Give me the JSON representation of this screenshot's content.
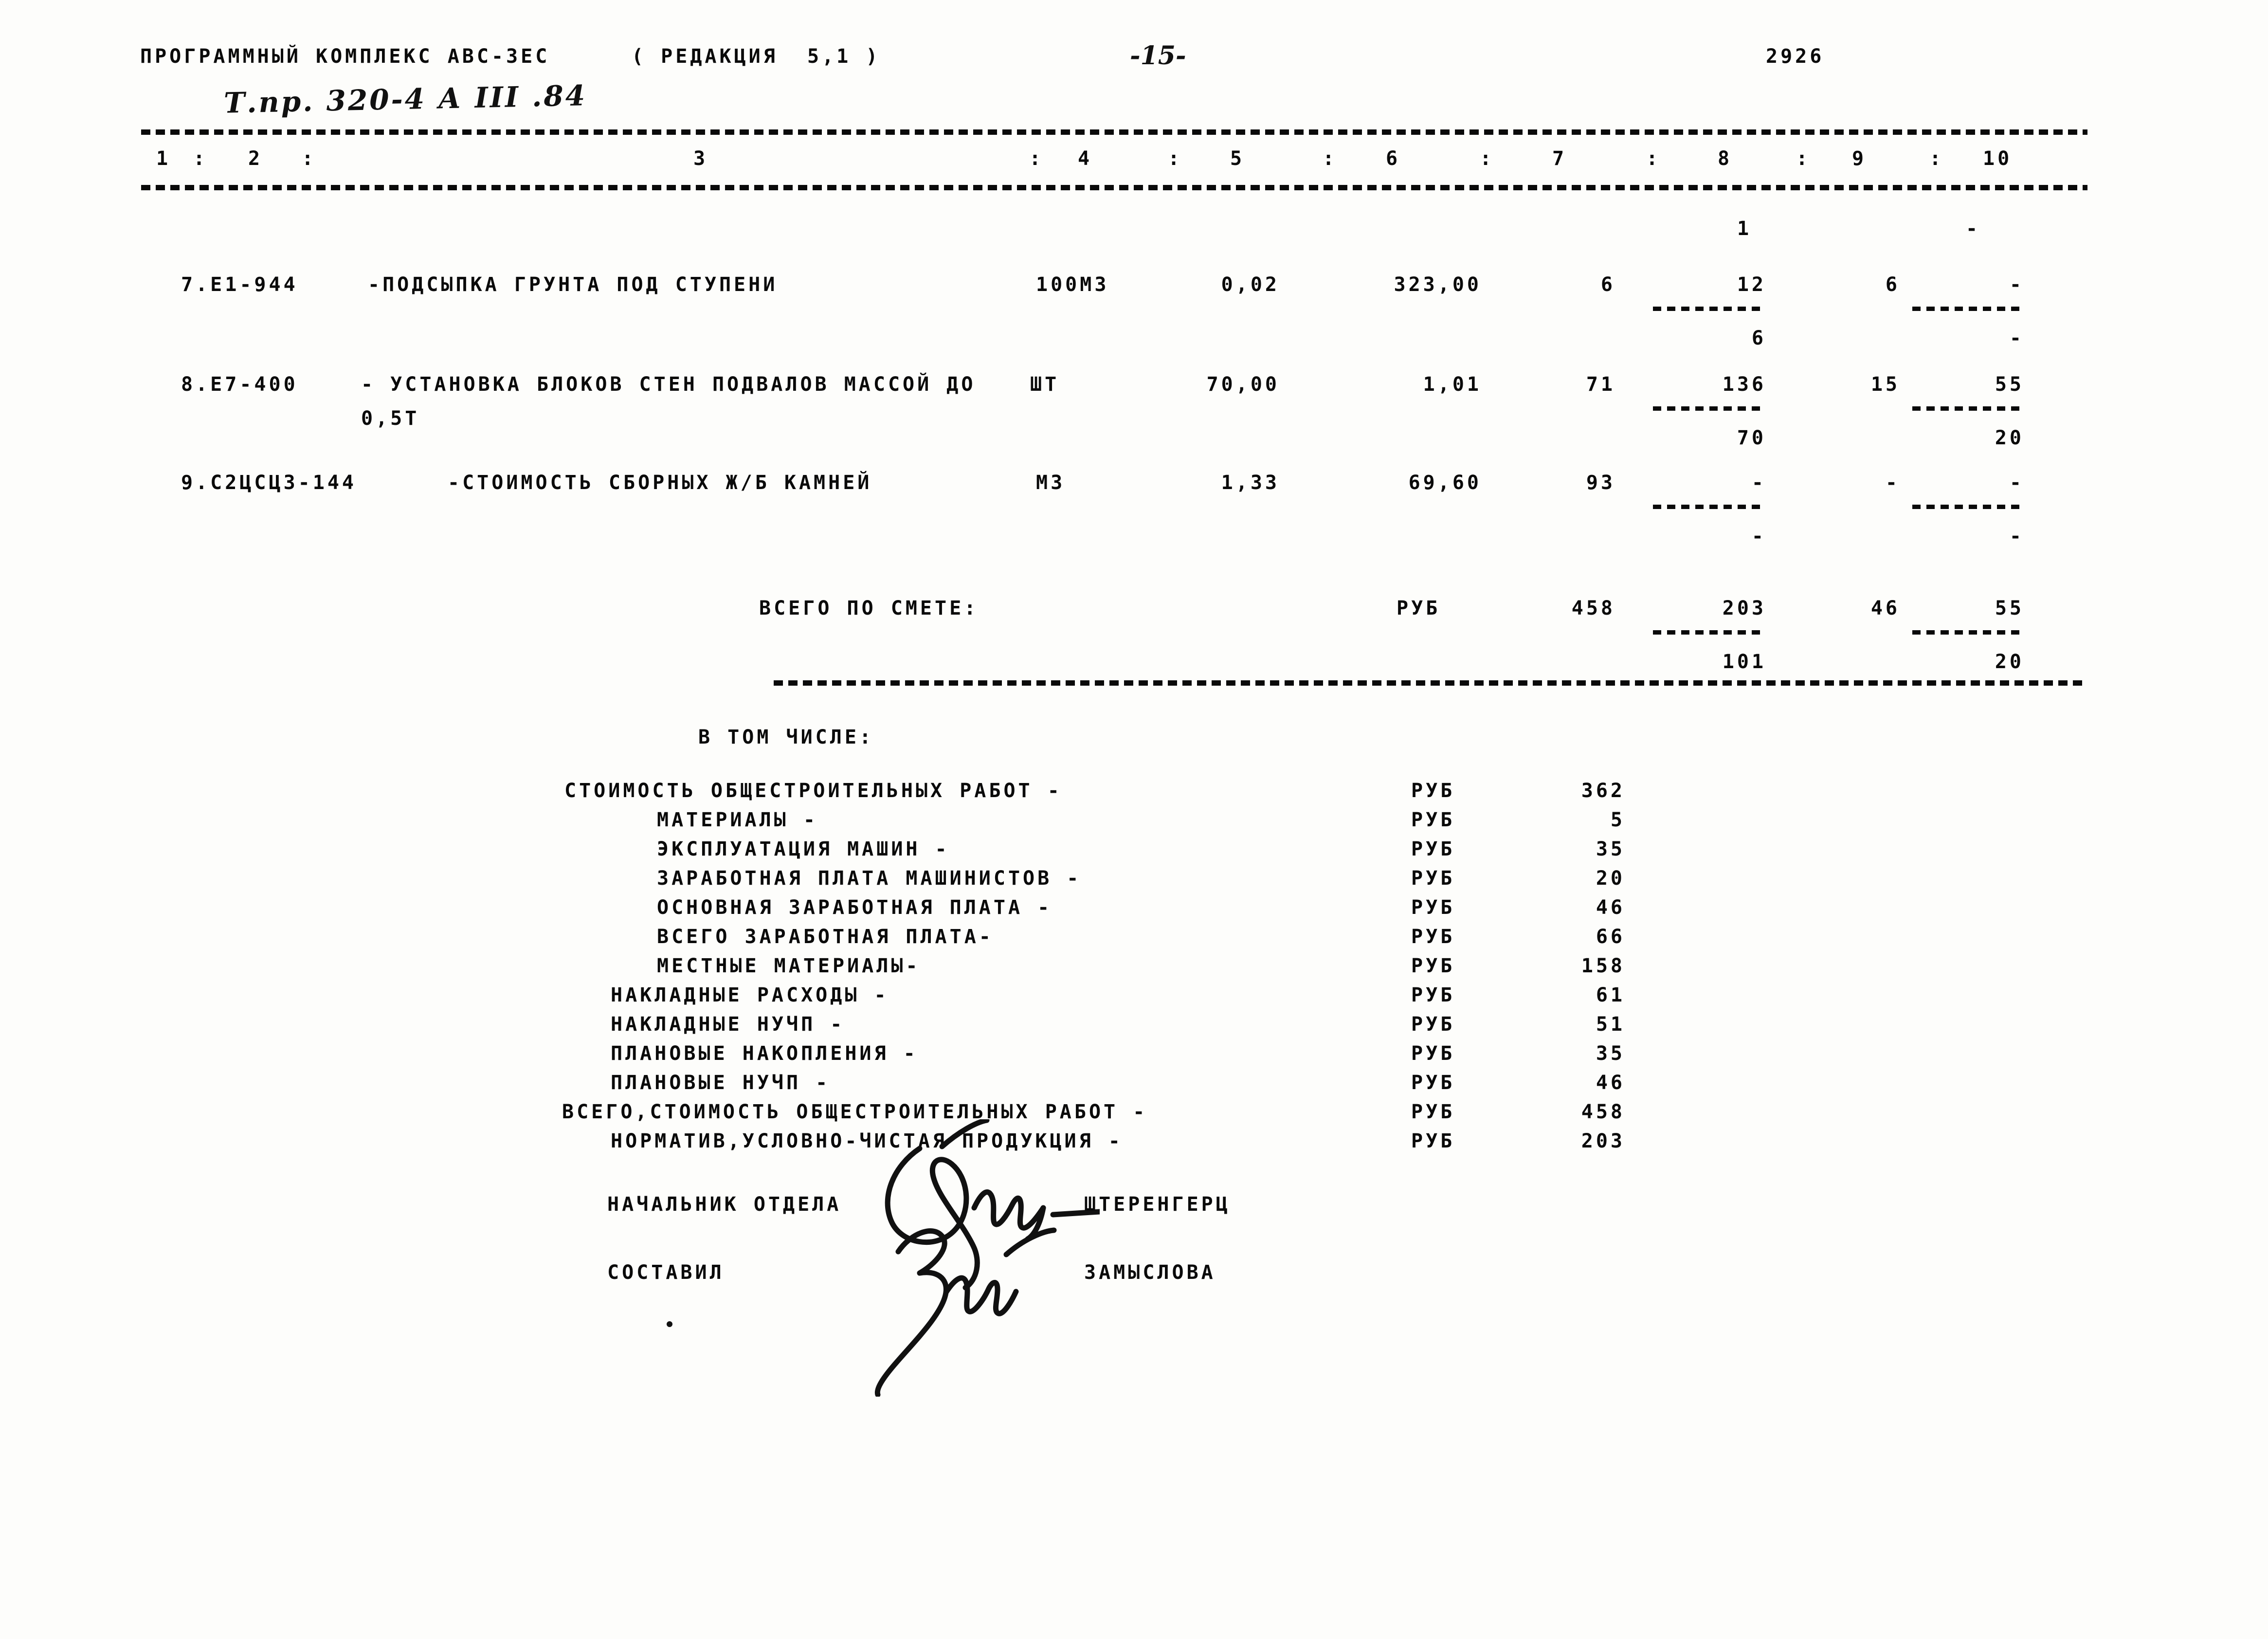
{
  "header": {
    "program_title": "ПРОГРАММНЫЙ КОМПЛЕКС АВС-3ЕС",
    "edition": "( РЕДАКЦИЯ  5,1 )",
    "page_number": "-15-",
    "doc_code": "2926",
    "handwritten_ref": "Т.пр. 320-4 А III .84"
  },
  "table": {
    "column_headers": [
      "1",
      ":",
      "2",
      ":",
      "3",
      ":",
      "4",
      ":",
      "5",
      ":",
      "6",
      ":",
      "7",
      ":",
      "8",
      ":",
      "9",
      ":",
      "10"
    ],
    "rows": [
      {
        "code": "7.Е1-944",
        "description": "-ПОДСЫПКА ГРУНТА ПОД СТУПЕНИ",
        "description_cont": "",
        "unit": "100М3",
        "qty": "0,02",
        "price": "323,00",
        "col7": "6",
        "col8_upper": "1",
        "col8": "12",
        "col8_sub": "6",
        "col9": "6",
        "col10_upper": "-",
        "col10": "-",
        "col10_sub": "-"
      },
      {
        "code": "8.Е7-400",
        "description": "- УСТАНОВКА БЛОКОВ СТЕН ПОДВАЛОВ МАССОЙ ДО",
        "description_cont": "0,5Т",
        "unit": "ШТ",
        "qty": "70,00",
        "price": "1,01",
        "col7": "71",
        "col8_upper": "",
        "col8": "136",
        "col8_sub": "70",
        "col9": "15",
        "col10_upper": "",
        "col10": "55",
        "col10_sub": "20"
      },
      {
        "code": "9.С2ЦСЦ3-144",
        "description": "-СТОИМОСТЬ СБОРНЫХ Ж/Б КАМНЕЙ",
        "description_cont": "",
        "unit": "М3",
        "qty": "1,33",
        "price": "69,60",
        "col7": "93",
        "col8_upper": "",
        "col8": "-",
        "col8_sub": "-",
        "col9": "-",
        "col10_upper": "",
        "col10": "-",
        "col10_sub": "-"
      }
    ],
    "total_row": {
      "label": "ВСЕГО ПО СМЕТЕ:",
      "unit": "РУБ",
      "col7": "458",
      "col8": "203",
      "col8_sub": "101",
      "col9": "46",
      "col10": "55",
      "col10_sub": "20"
    }
  },
  "breakdown": {
    "heading": "В ТОМ ЧИСЛЕ:",
    "currency_label": "РУБ",
    "items": [
      {
        "label": "СТОИМОСТЬ ОБЩЕСТРОИТЕЛЬНЫХ РАБОТ -",
        "indent": 0,
        "unit": "РУБ",
        "value": "362"
      },
      {
        "label": "МАТЕРИАЛЫ -",
        "indent": 1,
        "unit": "РУБ",
        "value": "5"
      },
      {
        "label": "ЭКСПЛУАТАЦИЯ МАШИН -",
        "indent": 1,
        "unit": "РУБ",
        "value": "35"
      },
      {
        "label": "ЗАРАБОТНАЯ ПЛАТА МАШИНИСТОВ -",
        "indent": 1,
        "unit": "РУБ",
        "value": "20"
      },
      {
        "label": "ОСНОВНАЯ ЗАРАБОТНАЯ ПЛАТА -",
        "indent": 1,
        "unit": "РУБ",
        "value": "46"
      },
      {
        "label": "ВСЕГО ЗАРАБОТНАЯ ПЛАТА-",
        "indent": 1,
        "unit": "РУБ",
        "value": "66"
      },
      {
        "label": "МЕСТНЫЕ МАТЕРИАЛЫ-",
        "indent": 1,
        "unit": "РУБ",
        "value": "158"
      },
      {
        "label": "НАКЛАДНЫЕ РАСХОДЫ -",
        "indent": 2,
        "unit": "РУБ",
        "value": "61"
      },
      {
        "label": "НАКЛАДНЫЕ НУЧП -",
        "indent": 2,
        "unit": "РУБ",
        "value": "51"
      },
      {
        "label": "ПЛАНОВЫЕ НАКОПЛЕНИЯ -",
        "indent": 2,
        "unit": "РУБ",
        "value": "35"
      },
      {
        "label": "ПЛАНОВЫЕ НУЧП -",
        "indent": 2,
        "unit": "РУБ",
        "value": "46"
      },
      {
        "label": "ВСЕГО,СТОИМОСТЬ ОБЩЕСТРОИТЕЛЬНЫХ РАБОТ -",
        "indent": 0,
        "unit": "РУБ",
        "value": "458"
      },
      {
        "label": "НОРМАТИВ,УСЛОВНО-ЧИСТАЯ ПРОДУКЦИЯ -",
        "indent": 1,
        "unit": "РУБ",
        "value": "203"
      }
    ]
  },
  "signatures": [
    {
      "role": "НАЧАЛЬНИК ОТДЕЛА",
      "name": "ШТЕРЕНГЕРЦ"
    },
    {
      "role": "СОСТАВИЛ",
      "name": "ЗАМЫСЛОВА"
    }
  ]
}
